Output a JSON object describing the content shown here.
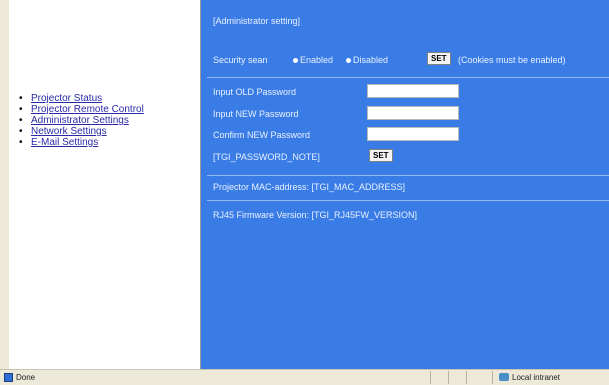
{
  "nav": {
    "items": [
      {
        "label": "Projector Status"
      },
      {
        "label": "Projector Remote Control"
      },
      {
        "label": "Administrator Settings"
      },
      {
        "label": "Network Settings"
      },
      {
        "label": "E-Mail Settings"
      }
    ]
  },
  "admin": {
    "section_title": "[Administrator setting]",
    "security_label": "Security sean",
    "enabled_label": "Enabled",
    "disabled_label": "Disabled",
    "set_label": "SET",
    "cookies_note": "(Cookies must be enabled)",
    "old_password_label": "Input OLD Password",
    "new_password_label": "Input NEW Password",
    "confirm_password_label": "Confirm NEW Password",
    "old_password_value": "",
    "new_password_value": "",
    "confirm_password_value": "",
    "password_note": "[TGI_PASSWORD_NOTE]",
    "password_set_label": "SET",
    "mac_label": "Projector MAC-address: [TGI_MAC_ADDRESS]",
    "firmware_label": "RJ45 Firmware Version: [TGI_RJ45FW_VERSION]"
  },
  "statusbar": {
    "status": "Done",
    "zone": "Local intranet"
  }
}
